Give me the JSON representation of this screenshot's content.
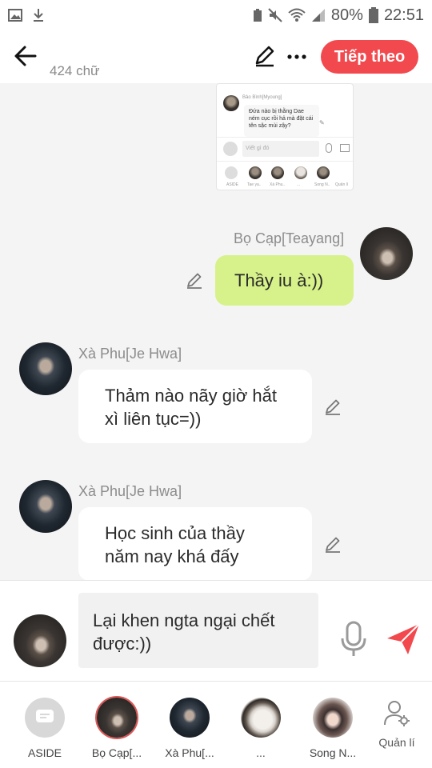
{
  "status_bar": {
    "battery": "80%",
    "time": "22:51"
  },
  "header": {
    "word_count": "424 chữ",
    "next_label": "Tiếp theo"
  },
  "screenshot_thumb": {
    "sender": "Bảo Bình[Myoung]",
    "message": "Đứa nào bị thằng Dae ném cục rồi hả mà đặt cái tên sặc mùi zậy?",
    "input_placeholder": "Viết gì đó",
    "cast": [
      "ASIDE",
      "Tae ya..",
      "Xà Phu..",
      "...",
      "Song N..",
      "Quản lí"
    ]
  },
  "messages": [
    {
      "sender": "Bọ Cạp[Teayang]",
      "side": "right",
      "lines": [
        "Thầy iu à:))"
      ]
    },
    {
      "sender": "Xà Phu[Je Hwa]",
      "side": "left",
      "lines": [
        "Thảm nào nãy giờ hắt",
        "xì liên tục=))"
      ]
    },
    {
      "sender": "Xà Phu[Je Hwa]",
      "side": "left",
      "lines": [
        "Học sinh của thầy",
        "năm nay khá đấy"
      ]
    }
  ],
  "composer": {
    "lines": [
      "Lại khen ngta ngại chết",
      "được:))"
    ]
  },
  "cast_bar": [
    {
      "label": "ASIDE"
    },
    {
      "label": "Bọ Cạp[..."
    },
    {
      "label": "Xà Phu[..."
    },
    {
      "label": "..."
    },
    {
      "label": "Song N..."
    }
  ],
  "manage_label": "Quản lí",
  "colors": {
    "accent": "#f2494e",
    "my_bubble": "#d7f28a",
    "background": "#f4f4f4"
  }
}
